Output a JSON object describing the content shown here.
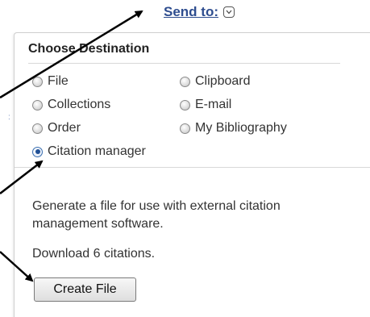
{
  "send_to": {
    "label": "Send to:",
    "chevron_icon": "chevron-down-icon"
  },
  "panel": {
    "title": "Choose Destination",
    "options": [
      {
        "label": "File",
        "checked": false
      },
      {
        "label": "Clipboard",
        "checked": false
      },
      {
        "label": "Collections",
        "checked": false
      },
      {
        "label": "E-mail",
        "checked": false
      },
      {
        "label": "Order",
        "checked": false
      },
      {
        "label": "My Bibliography",
        "checked": false
      },
      {
        "label": "Citation manager",
        "checked": true
      }
    ],
    "description": "Generate a file for use with external citation management software.",
    "download_text": "Download 6 citations.",
    "create_button": "Create File"
  },
  "colors": {
    "link": "#2e4d8f",
    "arrow": "#000000"
  }
}
